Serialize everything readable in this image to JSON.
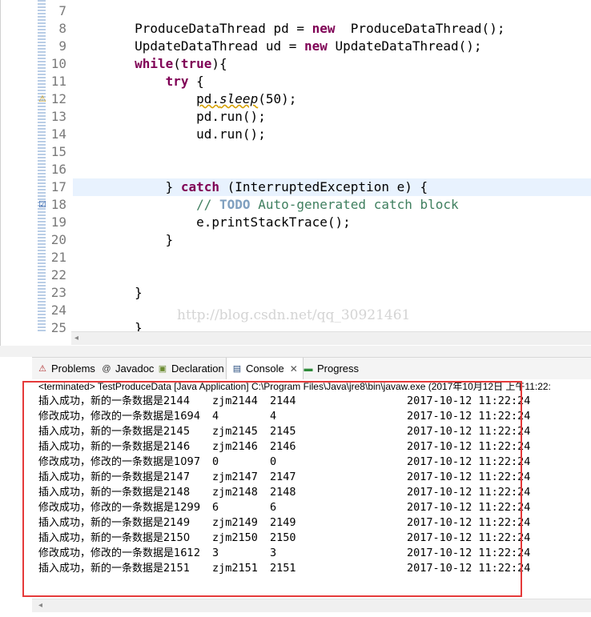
{
  "editor": {
    "lines": [
      {
        "num": "7",
        "html": ""
      },
      {
        "num": "8",
        "html": "        ProduceDataThread pd = <span class=\"kw\">new</span>  ProduceDataThread();"
      },
      {
        "num": "9",
        "html": "        UpdateDataThread ud = <span class=\"kw\">new</span> UpdateDataThread();"
      },
      {
        "num": "10",
        "html": "        <span class=\"kw\">while</span>(<span class=\"kw\">true</span>){"
      },
      {
        "num": "11",
        "html": "            <span class=\"kw\">try</span> {"
      },
      {
        "num": "12",
        "html": "                <span class=\"wavy\">pd.<span class=\"st\">sleep</span></span>(50);"
      },
      {
        "num": "13",
        "html": "                pd.run();"
      },
      {
        "num": "14",
        "html": "                ud.run();"
      },
      {
        "num": "15",
        "html": ""
      },
      {
        "num": "16",
        "html": ""
      },
      {
        "num": "17",
        "html": "            } <span class=\"kw\">catch</span> (InterruptedException e) {"
      },
      {
        "num": "18",
        "html": "                <span class=\"cm\">// <span class=\"todo\">TODO</span> Auto-generated catch block</span>"
      },
      {
        "num": "19",
        "html": "                e.printStackTrace();"
      },
      {
        "num": "20",
        "html": "            }"
      },
      {
        "num": "21",
        "html": ""
      },
      {
        "num": "22",
        "html": ""
      },
      {
        "num": "23",
        "html": "        }"
      },
      {
        "num": "24",
        "html": ""
      },
      {
        "num": "25",
        "html": "        }"
      }
    ],
    "watermark": "http://blog.csdn.net/qq_30921461"
  },
  "tabs": [
    {
      "label": "Problems",
      "icon": "problems-icon"
    },
    {
      "label": "Javadoc",
      "icon": "javadoc-icon"
    },
    {
      "label": "Declaration",
      "icon": "declaration-icon"
    },
    {
      "label": "Console",
      "icon": "console-icon"
    },
    {
      "label": "Progress",
      "icon": "progress-icon"
    }
  ],
  "console": {
    "terminated": "<terminated> TestProduceData [Java Application] C:\\Program Files\\Java\\jre8\\bin\\javaw.exe (2017年10月12日 上午11:22:",
    "rows": [
      [
        "插入成功，新的一条数据是2144",
        "zjm2144",
        "2144",
        "2017-10-12 11:22:24"
      ],
      [
        "修改成功，修改的一条数据是1694",
        "4",
        "4",
        "2017-10-12 11:22:24"
      ],
      [
        "插入成功，新的一条数据是2145",
        "zjm2145",
        "2145",
        "2017-10-12 11:22:24"
      ],
      [
        "插入成功，新的一条数据是2146",
        "zjm2146",
        "2146",
        "2017-10-12 11:22:24"
      ],
      [
        "修改成功，修改的一条数据是1097",
        "0",
        "0",
        "2017-10-12 11:22:24"
      ],
      [
        "插入成功，新的一条数据是2147",
        "zjm2147",
        "2147",
        "2017-10-12 11:22:24"
      ],
      [
        "插入成功，新的一条数据是2148",
        "zjm2148",
        "2148",
        "2017-10-12 11:22:24"
      ],
      [
        "修改成功，修改的一条数据是1299",
        "6",
        "6",
        "2017-10-12 11:22:24"
      ],
      [
        "插入成功，新的一条数据是2149",
        "zjm2149",
        "2149",
        "2017-10-12 11:22:24"
      ],
      [
        "插入成功，新的一条数据是2150",
        "zjm2150",
        "2150",
        "2017-10-12 11:22:24"
      ],
      [
        "修改成功，修改的一条数据是1612",
        "3",
        "3",
        "2017-10-12 11:22:24"
      ],
      [
        "插入成功，新的一条数据是2151",
        "zjm2151",
        "2151",
        "2017-10-12 11:22:24"
      ]
    ]
  },
  "colors": {
    "keyword": "#7f0055",
    "comment": "#3f7f5f",
    "highlight": "#e8f2fe",
    "annotation_box": "#e53a3a"
  }
}
